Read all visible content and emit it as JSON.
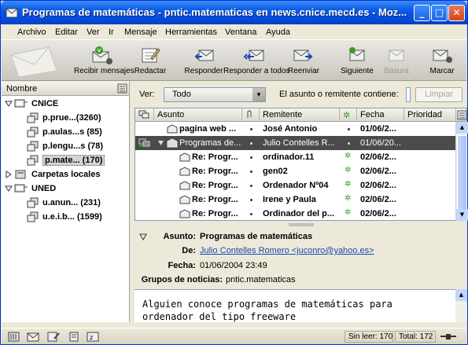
{
  "window": {
    "title": "Programas de matemáticas - pntic.matematicas en news.cnice.mecd.es - Moz..."
  },
  "menu": [
    "Archivo",
    "Editar",
    "Ver",
    "Ir",
    "Mensaje",
    "Herramientas",
    "Ventana",
    "Ayuda"
  ],
  "toolbar": {
    "get_msgs": "Recibir mensajes",
    "compose": "Redactar",
    "reply": "Responder",
    "reply_all": "Responder a todos",
    "forward": "Reenviar",
    "next": "Siguiente",
    "junk": "Basura",
    "mark": "Marcar"
  },
  "folders": {
    "header": "Nombre",
    "items": [
      {
        "label": "CNICE"
      },
      {
        "label": "p.prue...(3260)"
      },
      {
        "label": "p.aulas...s (85)"
      },
      {
        "label": "p.lengu...s (78)"
      },
      {
        "label": "p.mate... (170)"
      },
      {
        "label": "Carpetas locales"
      },
      {
        "label": "UNED"
      },
      {
        "label": "u.anun... (231)"
      },
      {
        "label": "u.e.i.b... (1599)"
      }
    ]
  },
  "search": {
    "view_label": "Ver:",
    "view_value": "Todo",
    "field_label": "El asunto o remitente contiene:",
    "clear_label": "Limpiar"
  },
  "threads": {
    "headers": {
      "subject": "Asunto",
      "sender": "Remitente",
      "date": "Fecha",
      "priority": "Prioridad"
    },
    "rows": [
      {
        "subject": "pagina web ...",
        "sender": "José Antonio",
        "date": "01/06/2..."
      },
      {
        "subject": "Programas de...",
        "sender": "Julio Contelles R...",
        "date": "01/06/20..."
      },
      {
        "subject": "Re: Progr...",
        "sender": "ordinador.11",
        "date": "02/06/2..."
      },
      {
        "subject": "Re: Progr...",
        "sender": "gen02",
        "date": "02/06/2..."
      },
      {
        "subject": "Re: Progr...",
        "sender": "Ordenador Nº04",
        "date": "02/06/2..."
      },
      {
        "subject": "Re: Progr...",
        "sender": "Irene y Paula",
        "date": "02/06/2..."
      },
      {
        "subject": "Re: Progr...",
        "sender": "Ordinador del p...",
        "date": "02/06/2..."
      }
    ]
  },
  "message": {
    "subject_label": "Asunto:",
    "subject": "Programas de matemáticas",
    "from_label": "De:",
    "from": "Julio Contelles Romero <juconro@yahoo.es>",
    "date_label": "Fecha:",
    "date": "01/06/2004 23:49",
    "groups_label": "Grupos de noticias:",
    "groups": "pntic.matematicas",
    "body_line1": "Alguien conoce programas de matemáticas para",
    "body_line2": "ordenador del tipo freeware"
  },
  "status": {
    "unread": "Sin leer: 170",
    "total": "Total: 172"
  }
}
